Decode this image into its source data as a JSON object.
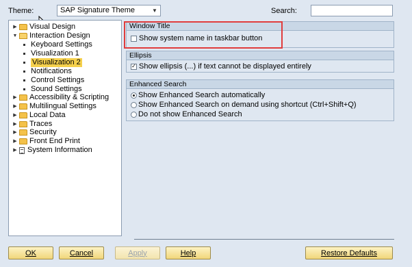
{
  "header": {
    "theme_label": "Theme:",
    "theme_value": "SAP Signature Theme",
    "search_label": "Search:",
    "search_value": ""
  },
  "tree": [
    {
      "label": "Visual Design",
      "type": "folder",
      "expander": "collapsed",
      "level": 0
    },
    {
      "label": "Interaction Design",
      "type": "folder-open",
      "expander": "expanded",
      "level": 0
    },
    {
      "label": "Keyboard Settings",
      "type": "leaf",
      "level": 1
    },
    {
      "label": "Visualization 1",
      "type": "leaf",
      "level": 1
    },
    {
      "label": "Visualization 2",
      "type": "leaf",
      "level": 1,
      "selected": true
    },
    {
      "label": "Notifications",
      "type": "leaf",
      "level": 1
    },
    {
      "label": "Control Settings",
      "type": "leaf",
      "level": 1
    },
    {
      "label": "Sound Settings",
      "type": "leaf",
      "level": 1
    },
    {
      "label": "Accessibility & Scripting",
      "type": "folder",
      "expander": "collapsed",
      "level": 0
    },
    {
      "label": "Multilingual Settings",
      "type": "folder",
      "expander": "collapsed",
      "level": 0
    },
    {
      "label": "Local Data",
      "type": "folder",
      "expander": "collapsed",
      "level": 0
    },
    {
      "label": "Traces",
      "type": "folder",
      "expander": "collapsed",
      "level": 0
    },
    {
      "label": "Security",
      "type": "folder",
      "expander": "collapsed",
      "level": 0
    },
    {
      "label": "Front End Print",
      "type": "folder",
      "expander": "collapsed",
      "level": 0
    },
    {
      "label": "System Information",
      "type": "doc",
      "expander": "collapsed",
      "level": 0
    }
  ],
  "groups": {
    "window_title": {
      "title": "Window Title",
      "option": {
        "label": "Show system name in taskbar button",
        "checked": false
      }
    },
    "ellipsis": {
      "title": "Ellipsis",
      "option": {
        "label": "Show ellipsis (...) if text cannot be displayed entirely",
        "checked": true
      }
    },
    "enhanced_search": {
      "title": "Enhanced Search",
      "options": [
        {
          "label": "Show Enhanced Search automatically",
          "selected": true
        },
        {
          "label": "Show Enhanced Search on demand using shortcut (Ctrl+Shift+Q)",
          "selected": false
        },
        {
          "label": "Do not show Enhanced Search",
          "selected": false
        }
      ]
    }
  },
  "buttons": {
    "ok": "OK",
    "cancel": "Cancel",
    "apply": "Apply",
    "help": "Help",
    "restore": "Restore Defaults"
  },
  "colors": {
    "background": "#dfe7f1",
    "selection": "#f5d04c",
    "highlight": "#e03c3c",
    "button": "#f1d67a"
  },
  "icons": [
    "chevron-down-icon",
    "expand-arrow-icon",
    "collapse-arrow-icon",
    "folder-icon",
    "folder-open-icon",
    "document-icon",
    "cursor-icon"
  ]
}
